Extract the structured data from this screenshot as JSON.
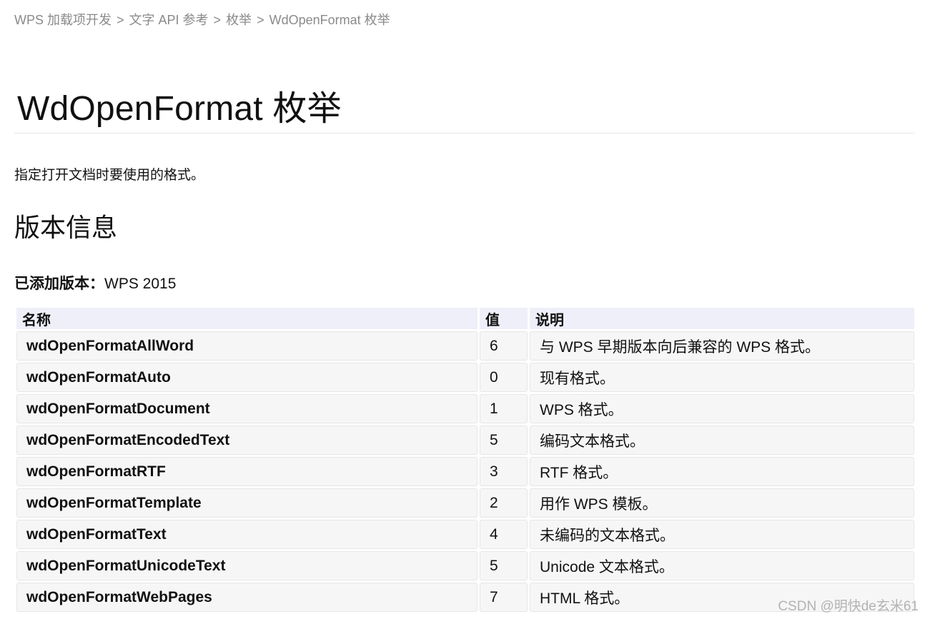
{
  "breadcrumb": {
    "items": [
      "WPS 加载项开发",
      "文字 API 参考",
      "枚举"
    ],
    "separator": ">",
    "current": "WdOpenFormat 枚举"
  },
  "page": {
    "title": "WdOpenFormat 枚举",
    "description": "指定打开文档时要使用的格式。",
    "section_heading": "版本信息",
    "version_label": "已添加版本：",
    "version_value": "WPS 2015"
  },
  "table": {
    "headers": [
      "名称",
      "值",
      "说明"
    ],
    "rows": [
      {
        "name": "wdOpenFormatAllWord",
        "value": "6",
        "description": "与 WPS 早期版本向后兼容的 WPS 格式。"
      },
      {
        "name": "wdOpenFormatAuto",
        "value": "0",
        "description": "现有格式。"
      },
      {
        "name": "wdOpenFormatDocument",
        "value": "1",
        "description": "WPS 格式。"
      },
      {
        "name": "wdOpenFormatEncodedText",
        "value": "5",
        "description": "编码文本格式。"
      },
      {
        "name": "wdOpenFormatRTF",
        "value": "3",
        "description": "RTF 格式。"
      },
      {
        "name": "wdOpenFormatTemplate",
        "value": "2",
        "description": "用作 WPS 模板。"
      },
      {
        "name": "wdOpenFormatText",
        "value": "4",
        "description": "未编码的文本格式。"
      },
      {
        "name": "wdOpenFormatUnicodeText",
        "value": "5",
        "description": "Unicode 文本格式。"
      },
      {
        "name": "wdOpenFormatWebPages",
        "value": "7",
        "description": "HTML 格式。"
      }
    ]
  },
  "watermark": "CSDN @明快de玄米61",
  "colors": {
    "header_bg": "#eeeff8",
    "cell_bg": "#f6f6f6",
    "breadcrumb_text": "#8a8a8a"
  }
}
